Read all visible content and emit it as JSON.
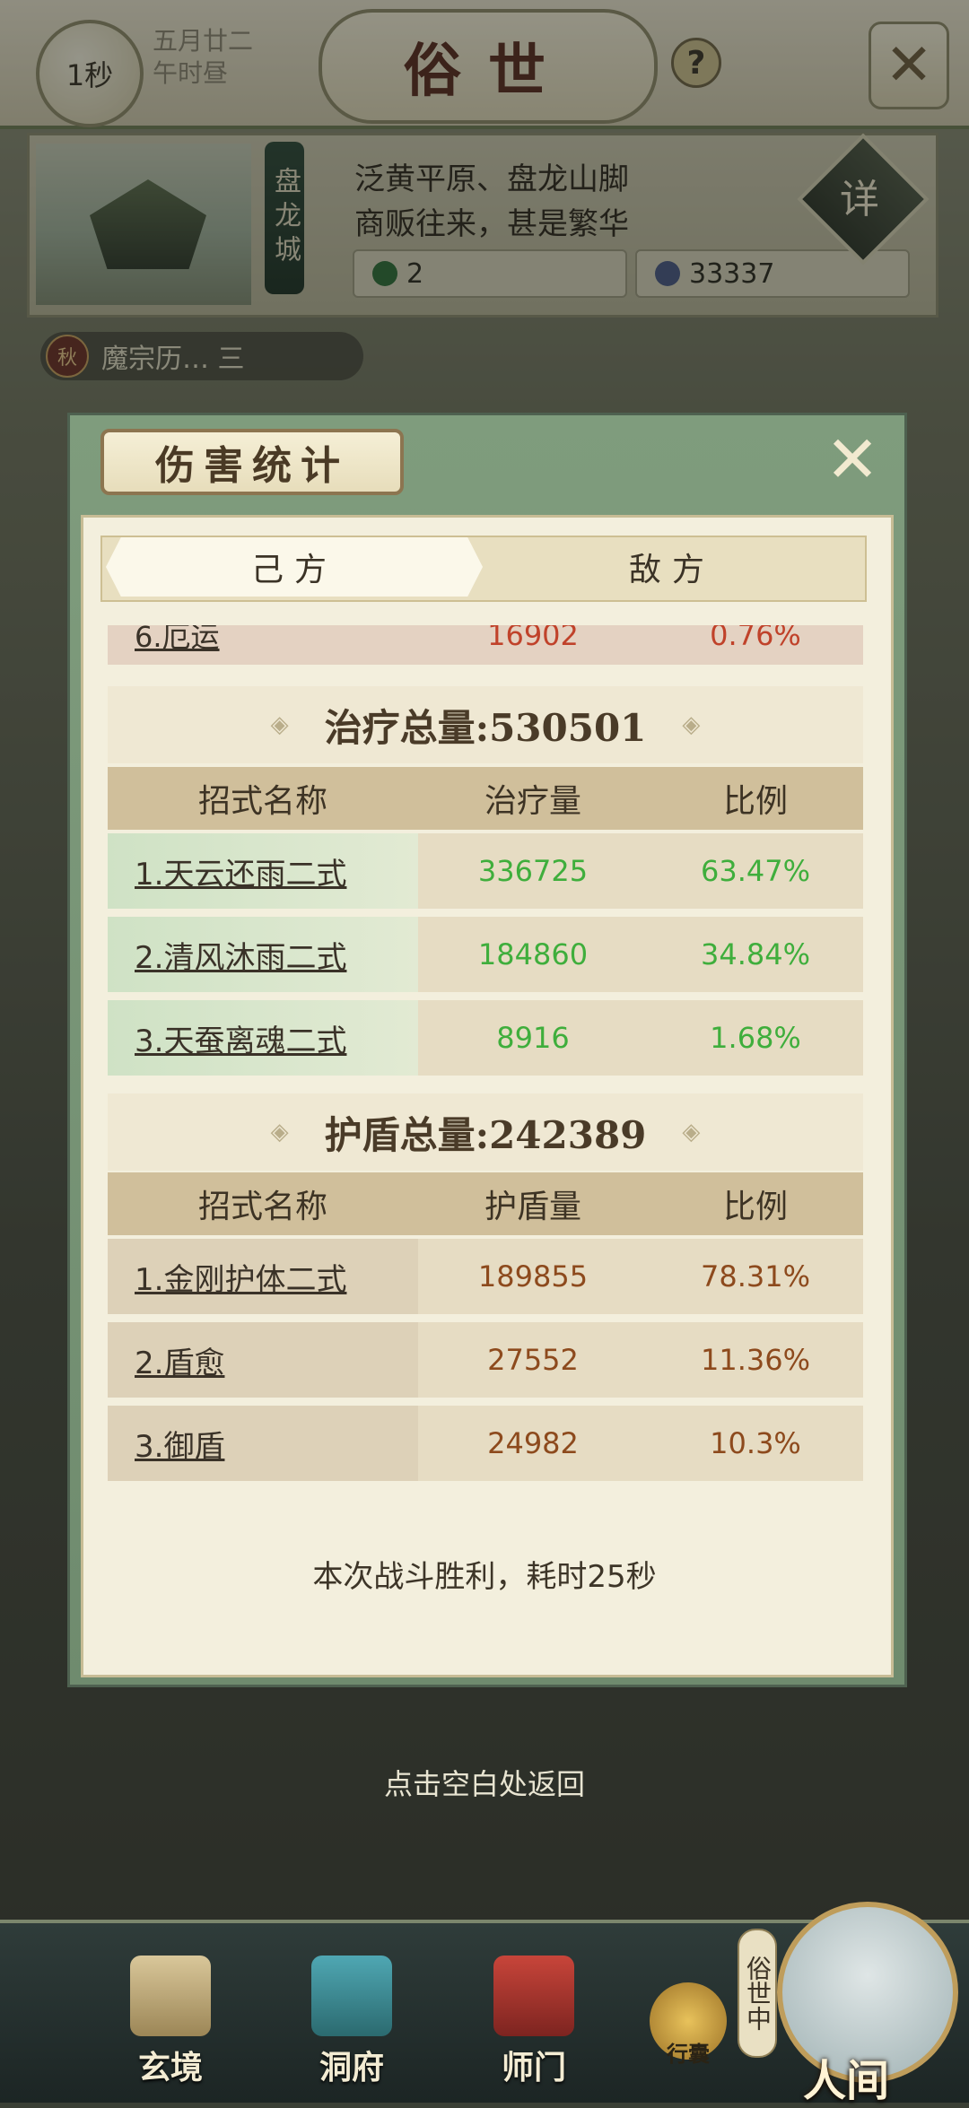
{
  "header": {
    "timer": "1秒",
    "date_line1": "五月廿二",
    "date_line2": "午时昼",
    "title": "俗世",
    "help_icon": "?"
  },
  "city": {
    "name": "盘龙城",
    "desc_line1": "泛黄平原、盘龙山脚",
    "desc_line2": "商贩往来，甚是繁华",
    "detail_label": "详",
    "resource1": "2",
    "resource2": "33337"
  },
  "realm_tag": {
    "icon_text": "秋",
    "text": "魔宗历… 三"
  },
  "dialog": {
    "title": "伤害统计",
    "tabs": [
      "己方",
      "敌方"
    ],
    "partial_row": {
      "name": "6.厄运",
      "value": "16902",
      "ratio": "0.76%"
    },
    "heal": {
      "title": "治疗总量:530501",
      "headers": [
        "招式名称",
        "治疗量",
        "比例"
      ],
      "rows": [
        {
          "name": "1.天云还雨二式",
          "value": "336725",
          "ratio": "63.47%"
        },
        {
          "name": "2.清风沐雨二式",
          "value": "184860",
          "ratio": "34.84%"
        },
        {
          "name": "3.天蚕离魂二式",
          "value": "8916",
          "ratio": "1.68%"
        }
      ]
    },
    "shield": {
      "title": "护盾总量:242389",
      "headers": [
        "招式名称",
        "护盾量",
        "比例"
      ],
      "rows": [
        {
          "name": "1.金刚护体二式",
          "value": "189855",
          "ratio": "78.31%"
        },
        {
          "name": "2.盾愈",
          "value": "27552",
          "ratio": "11.36%"
        },
        {
          "name": "3.御盾",
          "value": "24982",
          "ratio": "10.3%"
        }
      ]
    },
    "result": "本次战斗胜利，耗时25秒"
  },
  "back_hint": "点击空白处返回",
  "nav": {
    "items": [
      "玄境",
      "洞府",
      "师门"
    ],
    "bag": "行囊",
    "world_badge": "俗世中",
    "world": "人间"
  },
  "colors": {
    "heal_value": "#3fae3c",
    "shield_value": "#8d4a1d",
    "dialog_frame": "#7f9c7d"
  }
}
